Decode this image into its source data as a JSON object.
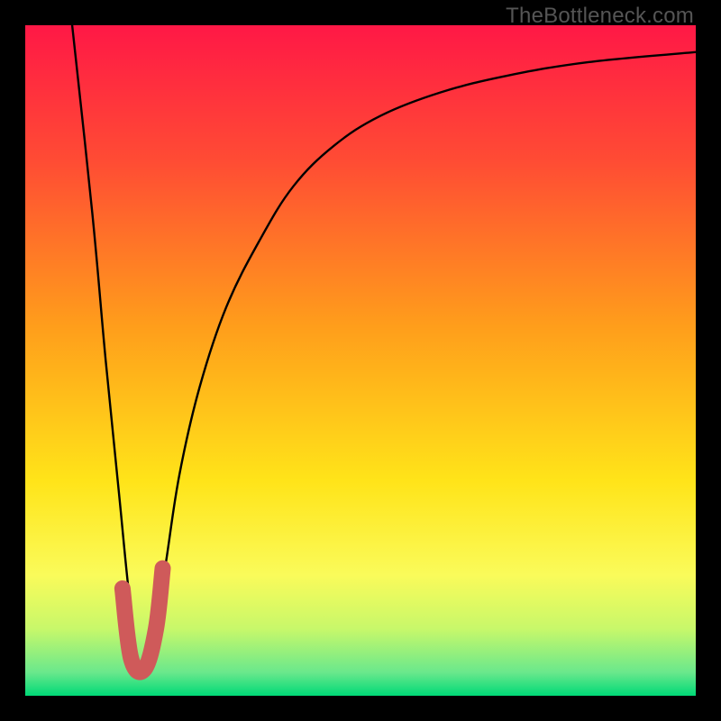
{
  "watermark": "TheBottleneck.com",
  "colors": {
    "frame": "#000000",
    "gradient_stops": [
      {
        "offset": 0.0,
        "color": "#ff1846"
      },
      {
        "offset": 0.2,
        "color": "#ff4b34"
      },
      {
        "offset": 0.45,
        "color": "#ff9e1b"
      },
      {
        "offset": 0.68,
        "color": "#ffe419"
      },
      {
        "offset": 0.82,
        "color": "#fafb5a"
      },
      {
        "offset": 0.9,
        "color": "#c8f86a"
      },
      {
        "offset": 0.965,
        "color": "#6ae88c"
      },
      {
        "offset": 1.0,
        "color": "#00d977"
      }
    ],
    "curve": "#000000",
    "marker_fill": "#cf5a5a",
    "marker_stroke": "#cf5a5a"
  },
  "chart_data": {
    "type": "line",
    "title": "",
    "xlabel": "",
    "ylabel": "",
    "xlim": [
      0,
      100
    ],
    "ylim": [
      0,
      100
    ],
    "series": [
      {
        "name": "bottleneck-curve",
        "x": [
          7,
          10,
          12,
          14,
          15.5,
          17,
          19,
          21,
          23,
          26,
          30,
          35,
          40,
          46,
          53,
          62,
          72,
          84,
          100
        ],
        "values": [
          100,
          72,
          50,
          30,
          15,
          4,
          7,
          20,
          33,
          46,
          58,
          68,
          76,
          82,
          86.5,
          90,
          92.5,
          94.5,
          96
        ]
      }
    ],
    "marker": {
      "name": "selected-range-hook",
      "path_xy": [
        [
          14.5,
          16
        ],
        [
          15.8,
          5.5
        ],
        [
          17.8,
          4
        ],
        [
          19.5,
          10
        ],
        [
          20.5,
          19
        ]
      ]
    }
  }
}
